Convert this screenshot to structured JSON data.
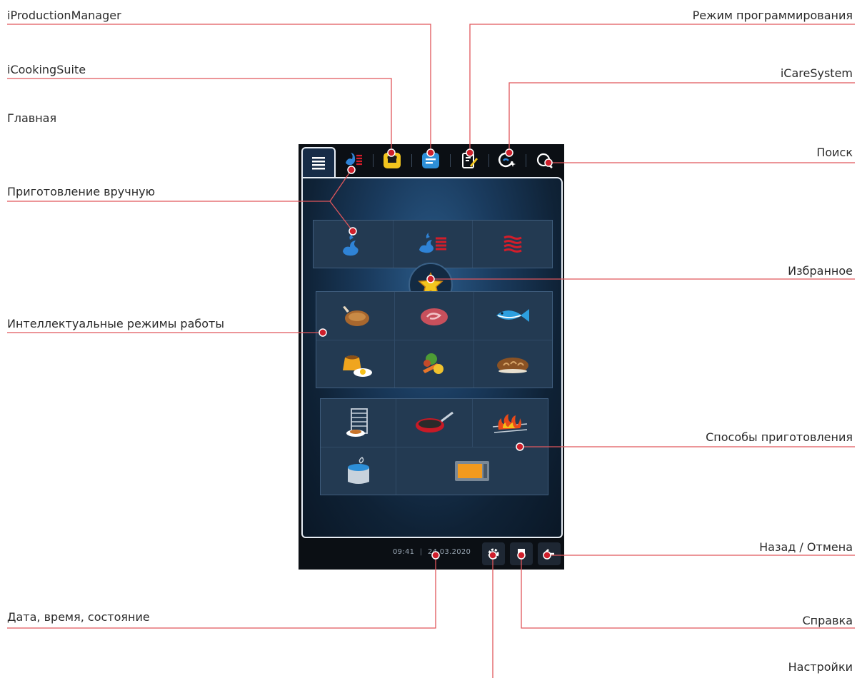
{
  "labels": {
    "iproduction_manager": "iProductionManager",
    "icooking_suite": "iCookingSuite",
    "home": "Главная",
    "manual_cooking": "Приготовление вручную",
    "intelligent_modes": "Интеллектуальные режимы работы",
    "date_time_status": "Дата, время, состояние",
    "programming_mode": "Режим программирования",
    "icare_system": "iCareSystem",
    "search": "Поиск",
    "favorites": "Избранное",
    "cooking_methods": "Способы приготовления",
    "back_cancel": "Назад / Отмена",
    "help": "Справка",
    "settings": "Настройки"
  },
  "device": {
    "footer": {
      "time": "09:41",
      "date": "24.03.2020"
    }
  },
  "icons": {
    "tabs": [
      "menu-icon",
      "combi-mode-icon",
      "icookingsuite-icon",
      "iproductionmanager-icon",
      "programming-icon",
      "icaresystem-icon",
      "search-icon"
    ],
    "manual_modes": [
      "steam-icon",
      "combi-steam-convection-icon",
      "convection-heat-icon"
    ],
    "favorites": "star-icon",
    "intelligent_modes": [
      "poultry-icon",
      "meat-icon",
      "fish-icon",
      "egg-dishes-desserts-icon",
      "side-dishes-vegetables-icon",
      "bakery-icon"
    ],
    "cooking_methods": [
      "finishing-plates-icon",
      "pan-frying-icon",
      "grilling-icon",
      "boiling-pot-icon",
      "holding-cabinet-icon"
    ],
    "footer": [
      "settings-gear-icon",
      "help-icon",
      "back-arrow-icon"
    ]
  },
  "colors": {
    "leader_line": "#e0565b",
    "leader_dot": "#cf1f2b",
    "screen_blue": "#1a3b5e",
    "steam_blue": "#2f83d6",
    "heat_red": "#d31d2a",
    "tab_yellow": "#f2c51e",
    "tab_blue": "#2d8fd8"
  }
}
